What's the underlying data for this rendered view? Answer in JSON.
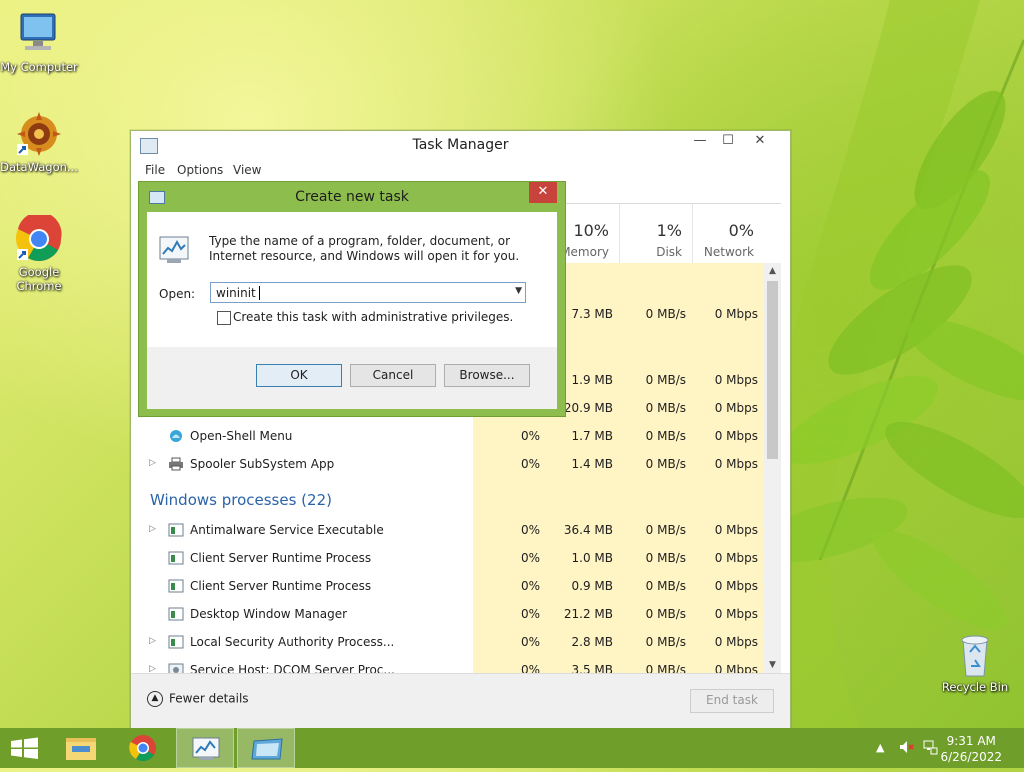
{
  "desktop": {
    "icons": [
      {
        "label": "My Computer",
        "icon": "computer-icon"
      },
      {
        "label": "DataWagon...",
        "icon": "datawagon-icon"
      },
      {
        "label": "Google Chrome",
        "icon": "chrome-icon"
      },
      {
        "label": "Recycle Bin",
        "icon": "recycle-bin-icon"
      }
    ]
  },
  "task_manager": {
    "title": "Task Manager",
    "controls": {
      "minimize": "—",
      "maximize": "☐",
      "close": "✕"
    },
    "menu": [
      "File",
      "Options",
      "View"
    ],
    "columns": [
      {
        "pct": "10%",
        "label": "Memory"
      },
      {
        "pct": "1%",
        "label": "Disk"
      },
      {
        "pct": "0%",
        "label": "Network"
      }
    ],
    "rows_top": [
      {
        "name": "",
        "cpu": "",
        "memory": "7.3 MB",
        "disk": "0 MB/s",
        "network": "0 Mbps"
      },
      {
        "name": "",
        "cpu": "",
        "memory": "1.9 MB",
        "disk": "0 MB/s",
        "network": "0 Mbps"
      },
      {
        "name": "",
        "cpu": "",
        "memory": "20.9 MB",
        "disk": "0 MB/s",
        "network": "0 Mbps"
      },
      {
        "name": "Open-Shell Menu",
        "cpu": "0%",
        "memory": "1.7 MB",
        "disk": "0 MB/s",
        "network": "0 Mbps",
        "expandable": false
      },
      {
        "name": "Spooler SubSystem App",
        "cpu": "0%",
        "memory": "1.4 MB",
        "disk": "0 MB/s",
        "network": "0 Mbps",
        "expandable": true
      }
    ],
    "group_title": "Windows processes (22)",
    "rows_windows": [
      {
        "name": "Antimalware Service Executable",
        "cpu": "0%",
        "memory": "36.4 MB",
        "disk": "0 MB/s",
        "network": "0 Mbps",
        "expandable": true
      },
      {
        "name": "Client Server Runtime Process",
        "cpu": "0%",
        "memory": "1.0 MB",
        "disk": "0 MB/s",
        "network": "0 Mbps",
        "expandable": false
      },
      {
        "name": "Client Server Runtime Process",
        "cpu": "0%",
        "memory": "0.9 MB",
        "disk": "0 MB/s",
        "network": "0 Mbps",
        "expandable": false
      },
      {
        "name": "Desktop Window Manager",
        "cpu": "0%",
        "memory": "21.2 MB",
        "disk": "0 MB/s",
        "network": "0 Mbps",
        "expandable": false
      },
      {
        "name": "Local Security Authority Process...",
        "cpu": "0%",
        "memory": "2.8 MB",
        "disk": "0 MB/s",
        "network": "0 Mbps",
        "expandable": true
      },
      {
        "name": "Service Host: DCOM Server Proc...",
        "cpu": "0%",
        "memory": "3.5 MB",
        "disk": "0 MB/s",
        "network": "0 Mbps",
        "expandable": true
      }
    ],
    "footer": {
      "fewer_details": "Fewer details",
      "end_task": "End task"
    }
  },
  "dialog": {
    "title": "Create new task",
    "close": "✕",
    "description": "Type the name of a program, folder, document, or Internet resource, and Windows will open it for you.",
    "open_label": "Open:",
    "open_value": "wininit",
    "admin_checkbox_label": "Create this task with administrative privileges.",
    "admin_checked": false,
    "buttons": {
      "ok": "OK",
      "cancel": "Cancel",
      "browse": "Browse..."
    }
  },
  "taskbar": {
    "items": [
      "start-button",
      "file-explorer-icon",
      "chrome-icon",
      "task-manager-icon",
      "run-dialog-icon"
    ],
    "tray": {
      "show_hidden": "▲",
      "time": "9:31 AM",
      "date": "6/26/2022"
    }
  },
  "colors": {
    "accent_green": "#8dbd4c",
    "taskbar": "#6f9e2a",
    "group_blue": "#2a63a8",
    "heat_yellow": "#fff4c4"
  }
}
